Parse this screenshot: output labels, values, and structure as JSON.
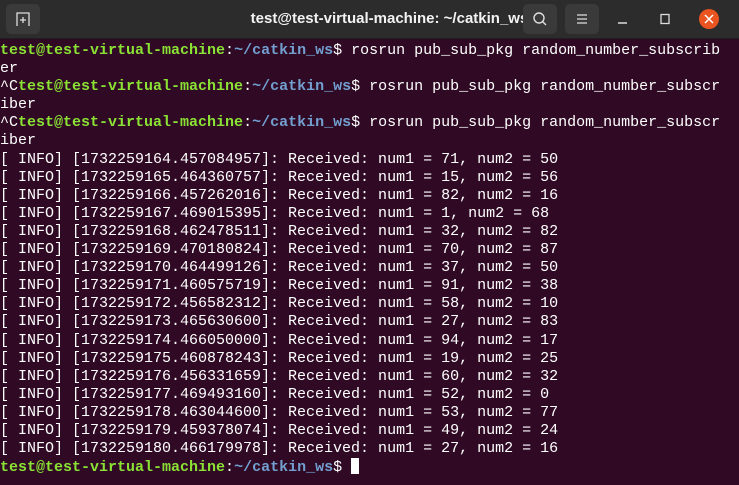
{
  "window": {
    "title": "test@test-virtual-machine: ~/catkin_ws",
    "new_tab_icon": "new-tab-icon",
    "search_icon": "search-icon",
    "menu_icon": "hamburger-menu-icon",
    "minimize_icon": "minimize-icon",
    "maximize_icon": "maximize-icon",
    "close_icon": "close-icon"
  },
  "colors": {
    "background": "#300a24",
    "user": "#8ae234",
    "path": "#729fcf",
    "close": "#e95420"
  },
  "terminal": {
    "lines": [
      [
        {
          "t": "test@test-virtual-machine",
          "c": "user"
        },
        {
          "t": ":"
        },
        {
          "t": "~/catkin_ws",
          "c": "path"
        },
        {
          "t": "$ rosrun pub_sub_pkg random_number_subscrib"
        }
      ],
      [
        {
          "t": "er"
        }
      ],
      [
        {
          "t": "^C"
        },
        {
          "t": "test@test-virtual-machine",
          "c": "user"
        },
        {
          "t": ":"
        },
        {
          "t": "~/catkin_ws",
          "c": "path"
        },
        {
          "t": "$ rosrun pub_sub_pkg random_number_subscr"
        }
      ],
      [
        {
          "t": "iber"
        }
      ],
      [
        {
          "t": "^C"
        },
        {
          "t": "test@test-virtual-machine",
          "c": "user"
        },
        {
          "t": ":"
        },
        {
          "t": "~/catkin_ws",
          "c": "path"
        },
        {
          "t": "$ rosrun pub_sub_pkg random_number_subscr"
        }
      ],
      [
        {
          "t": "iber"
        }
      ],
      [
        {
          "t": "[ INFO] [1732259164.457084957]: Received: num1 = 71, num2 = 50"
        }
      ],
      [
        {
          "t": "[ INFO] [1732259165.464360757]: Received: num1 = 15, num2 = 56"
        }
      ],
      [
        {
          "t": "[ INFO] [1732259166.457262016]: Received: num1 = 82, num2 = 16"
        }
      ],
      [
        {
          "t": "[ INFO] [1732259167.469015395]: Received: num1 = 1, num2 = 68"
        }
      ],
      [
        {
          "t": "[ INFO] [1732259168.462478511]: Received: num1 = 32, num2 = 82"
        }
      ],
      [
        {
          "t": "[ INFO] [1732259169.470180824]: Received: num1 = 70, num2 = 87"
        }
      ],
      [
        {
          "t": "[ INFO] [1732259170.464499126]: Received: num1 = 37, num2 = 50"
        }
      ],
      [
        {
          "t": "[ INFO] [1732259171.460575719]: Received: num1 = 91, num2 = 38"
        }
      ],
      [
        {
          "t": "[ INFO] [1732259172.456582312]: Received: num1 = 58, num2 = 10"
        }
      ],
      [
        {
          "t": "[ INFO] [1732259173.465630600]: Received: num1 = 27, num2 = 83"
        }
      ],
      [
        {
          "t": "[ INFO] [1732259174.466050000]: Received: num1 = 94, num2 = 17"
        }
      ],
      [
        {
          "t": "[ INFO] [1732259175.460878243]: Received: num1 = 19, num2 = 25"
        }
      ],
      [
        {
          "t": "[ INFO] [1732259176.456331659]: Received: num1 = 60, num2 = 32"
        }
      ],
      [
        {
          "t": "[ INFO] [1732259177.469493160]: Received: num1 = 52, num2 = 0"
        }
      ],
      [
        {
          "t": "[ INFO] [1732259178.463044600]: Received: num1 = 53, num2 = 77"
        }
      ],
      [
        {
          "t": "[ INFO] [1732259179.459378074]: Received: num1 = 49, num2 = 24"
        }
      ],
      [
        {
          "t": "[ INFO] [1732259180.466179978]: Received: num1 = 27, num2 = 16"
        }
      ]
    ],
    "prompt": {
      "user": "test@test-virtual-machine",
      "sep": ":",
      "path": "~/catkin_ws",
      "symbol": "$ "
    }
  }
}
